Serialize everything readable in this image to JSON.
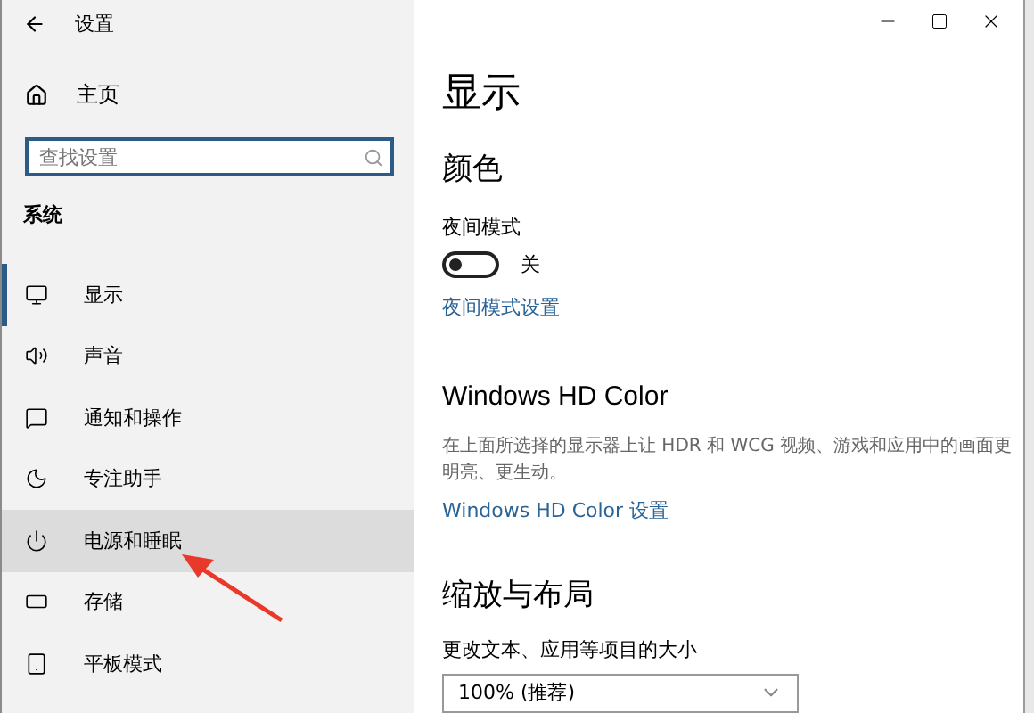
{
  "window": {
    "title": "设置"
  },
  "sidebar": {
    "home": "主页",
    "search": {
      "placeholder": "查找设置"
    },
    "section": "系统",
    "items": [
      {
        "label": "显示",
        "selected": true,
        "hovered": false
      },
      {
        "label": "声音",
        "selected": false,
        "hovered": false
      },
      {
        "label": "通知和操作",
        "selected": false,
        "hovered": false
      },
      {
        "label": "专注助手",
        "selected": false,
        "hovered": false
      },
      {
        "label": "电源和睡眠",
        "selected": false,
        "hovered": true
      },
      {
        "label": "存储",
        "selected": false,
        "hovered": false
      },
      {
        "label": "平板模式",
        "selected": false,
        "hovered": false
      }
    ]
  },
  "main": {
    "title": "显示",
    "color_section": {
      "heading": "颜色",
      "night_label": "夜间模式",
      "night_toggle": {
        "on": false,
        "state_text": "关"
      },
      "link": "夜间模式设置"
    },
    "hd_section": {
      "heading": "Windows HD Color",
      "description": "在上面所选择的显示器上让 HDR 和 WCG 视频、游戏和应用中的画面更明亮、更生动。",
      "link": "Windows HD Color 设置"
    },
    "scale_section": {
      "heading": "缩放与布局",
      "label": "更改文本、应用等项目的大小",
      "dropdown": {
        "value": "100% (推荐)"
      }
    }
  }
}
